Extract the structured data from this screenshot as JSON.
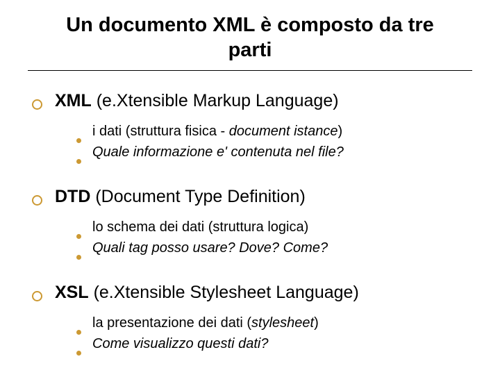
{
  "title": "Un documento XML è composto da tre parti",
  "sections": [
    {
      "head_bold": "XML",
      "head_rest": " (e.Xtensible Markup Language)",
      "items": [
        {
          "plain": "i dati (struttura fisica - ",
          "italic": "document istance",
          "tail": ")"
        },
        {
          "italic_full": "Quale informazione e' contenuta nel file?"
        }
      ]
    },
    {
      "head_bold": "DTD",
      "head_rest": " (Document Type Definition)",
      "items": [
        {
          "plain_full": "lo schema dei dati (struttura logica)"
        },
        {
          "italic_full": "Quali tag posso usare? Dove? Come?"
        }
      ]
    },
    {
      "head_bold": "XSL",
      "head_rest": " (e.Xtensible Stylesheet Language)",
      "items": [
        {
          "plain": "la presentazione dei dati (",
          "italic": "stylesheet",
          "tail": ")"
        },
        {
          "italic_full": "Come visualizzo questi dati?"
        }
      ]
    }
  ]
}
